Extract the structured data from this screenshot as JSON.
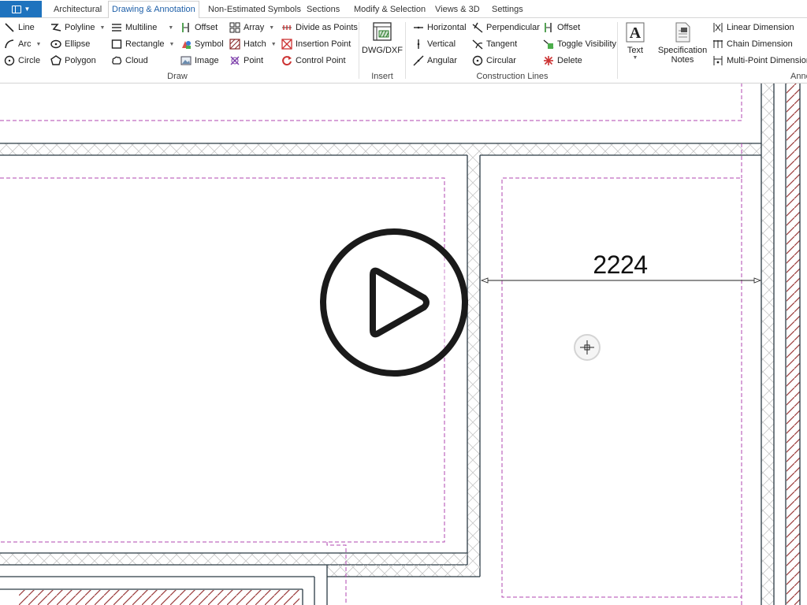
{
  "tabs": {
    "app_menu_label": "",
    "items": [
      {
        "label": "Architectural"
      },
      {
        "label": "Drawing & Annotation"
      },
      {
        "label": "Non-Estimated Symbols"
      },
      {
        "label": "Sections"
      },
      {
        "label": "Modify & Selection"
      },
      {
        "label": "Views & 3D"
      },
      {
        "label": "Settings"
      }
    ],
    "active_index": 1
  },
  "ribbon": {
    "draw": {
      "label": "Draw",
      "line": "Line",
      "arc": "Arc",
      "circle": "Circle",
      "polyline": "Polyline",
      "ellipse": "Ellipse",
      "polygon": "Polygon",
      "multiline": "Multiline",
      "rectangle": "Rectangle",
      "cloud": "Cloud",
      "offset": "Offset",
      "symbol": "Symbol",
      "image": "Image",
      "array": "Array",
      "hatch": "Hatch",
      "point": "Point",
      "divide_as_points": "Divide as Points",
      "insertion_point": "Insertion Point",
      "control_point": "Control Point"
    },
    "insert": {
      "label": "Insert",
      "dwg_dxf": "DWG/DXF"
    },
    "construction_lines": {
      "label": "Construction Lines",
      "horizontal": "Horizontal",
      "vertical": "Vertical",
      "angular": "Angular",
      "perpendicular": "Perpendicular",
      "tangent": "Tangent",
      "circular": "Circular",
      "offset": "Offset",
      "toggle_visibility": "Toggle Visibility",
      "delete": "Delete"
    },
    "annotation": {
      "label": "Anno",
      "text": "Text",
      "specification_notes_line1": "Specification",
      "specification_notes_line2": "Notes",
      "linear_dimension": "Linear Dimension",
      "chain_dimension": "Chain Dimension",
      "multi_point_dimension": "Multi-Point Dimension"
    }
  },
  "canvas": {
    "dimension_value": "2224",
    "colors": {
      "wall": "#2b3a44",
      "dashed": "#b247b2",
      "hatch": "#c9c9c9",
      "brick": "#9a3a3a"
    }
  }
}
